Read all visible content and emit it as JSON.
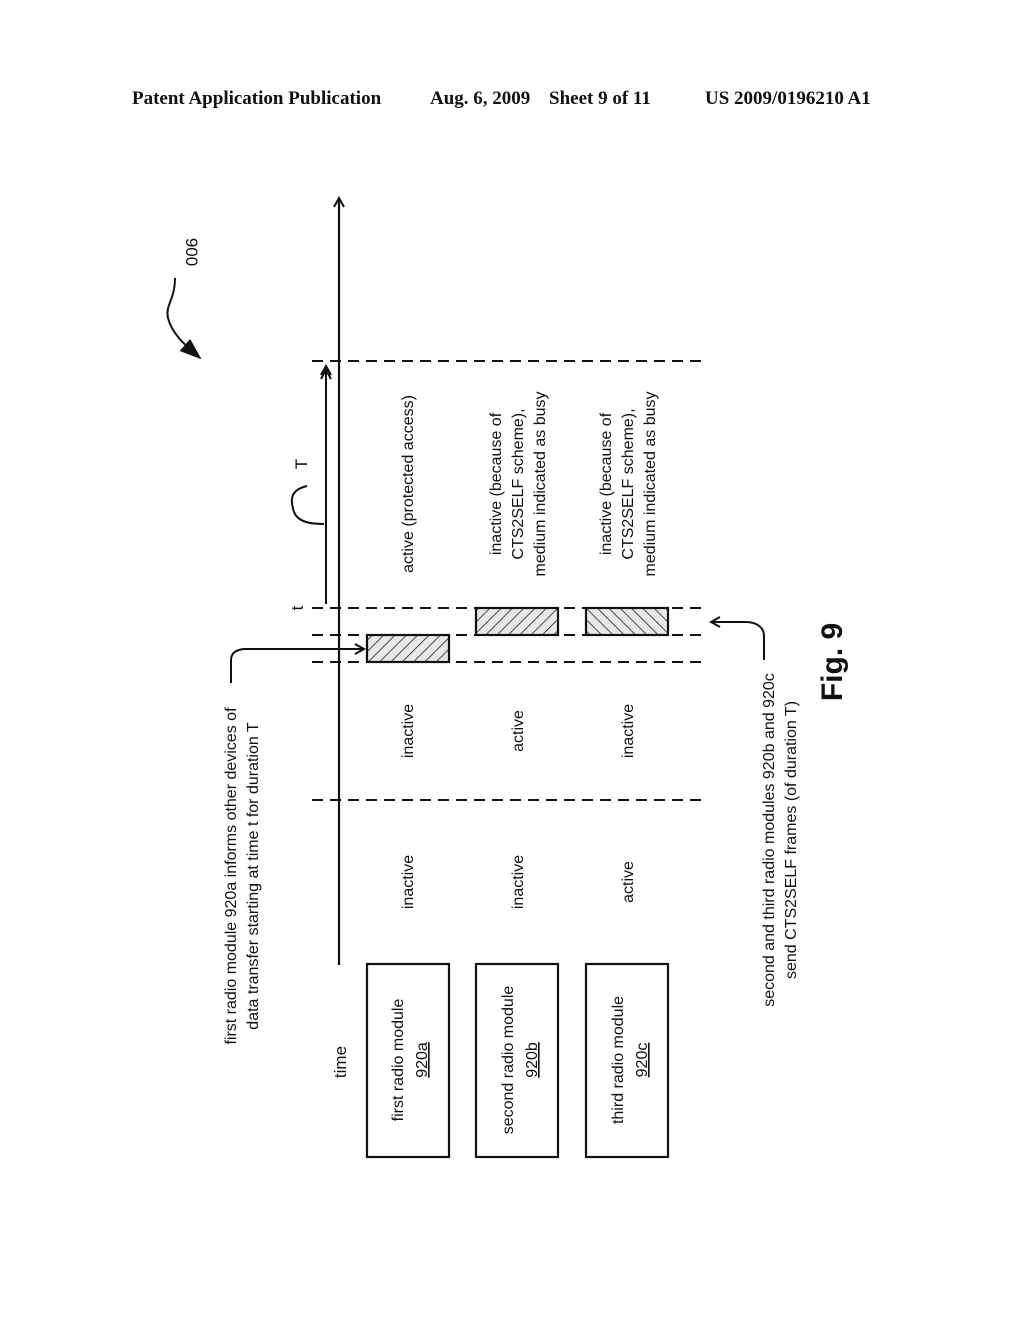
{
  "header": {
    "publication": "Patent Application Publication",
    "date": "Aug. 6, 2009",
    "sheet": "Sheet 9 of 11",
    "number": "US 2009/0196210 A1"
  },
  "figure": {
    "reference": "900",
    "caption": "Fig. 9",
    "axis_label": "time",
    "time_marker": "t",
    "duration_label": "T",
    "modules": [
      {
        "name": "first radio module",
        "ref": "920a"
      },
      {
        "name": "second radio module",
        "ref": "920b"
      },
      {
        "name": "third radio module",
        "ref": "920c"
      }
    ],
    "phases": [
      {
        "states": [
          "inactive",
          "inactive",
          "active"
        ]
      },
      {
        "states": [
          "inactive",
          "active",
          "inactive"
        ]
      },
      {
        "states": [
          [
            "active (protected access)"
          ],
          [
            "inactive (because of",
            "CTS2SELF scheme),",
            "medium indicated as busy"
          ],
          [
            "inactive (because of",
            "CTS2SELF scheme),",
            "medium indicated as busy"
          ]
        ]
      }
    ],
    "annotation_first": [
      "first radio module 920a informs other devices of",
      "data transfer starting at time t for duration T"
    ],
    "annotation_second": [
      "second and third radio modules 920b and 920c",
      "send CTS2SELF frames (of duration T)"
    ]
  }
}
